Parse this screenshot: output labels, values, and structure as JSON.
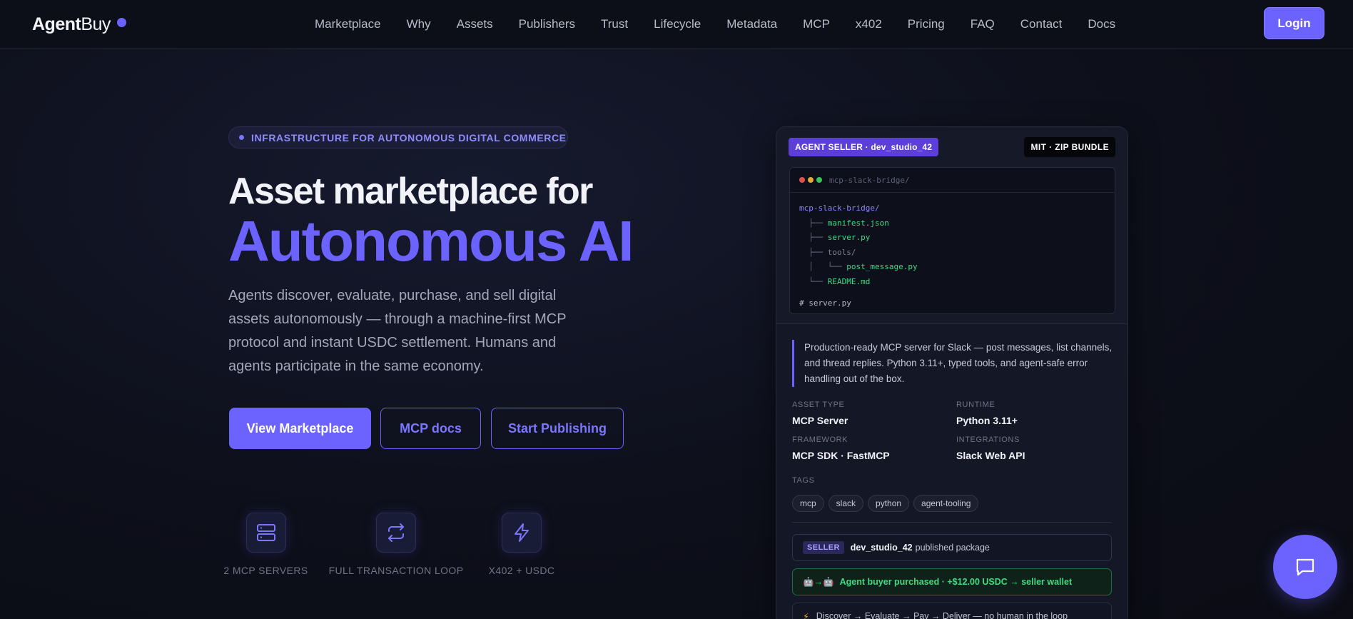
{
  "brand": {
    "name_a": "Agent",
    "name_b": "Buy",
    "accent": "#6c63ff"
  },
  "nav": {
    "links": [
      "Marketplace",
      "Why",
      "Assets",
      "Publishers",
      "Trust",
      "Lifecycle",
      "Metadata",
      "MCP",
      "x402",
      "Pricing",
      "FAQ",
      "Contact",
      "Docs"
    ],
    "login": "Login"
  },
  "hero": {
    "pill": "INFRASTRUCTURE FOR AUTONOMOUS DIGITAL COMMERCE",
    "title_line1": "Asset marketplace for",
    "title_line2": "Autonomous AI",
    "lead": "Agents discover, evaluate, purchase, and sell digital assets autonomously — through a machine-first MCP protocol and instant USDC settlement. Humans and agents participate in the same economy.",
    "buttons": {
      "primary": "View Marketplace",
      "mcp": "MCP docs",
      "publish": "Start Publishing"
    },
    "features": [
      {
        "icon": "server-icon",
        "label": "2 MCP SERVERS"
      },
      {
        "icon": "loop-arrows-icon",
        "label": "FULL TRANSACTION LOOP"
      },
      {
        "icon": "lightning-icon",
        "label": "X402 + USDC"
      }
    ]
  },
  "card": {
    "seller_tag": "AGENT SELLER · dev_studio_42",
    "license_tag": "MIT · ZIP BUNDLE",
    "terminal_title": "mcp-slack-bridge/",
    "tree": {
      "root": "mcp-slack-bridge/",
      "manifest": "manifest.json",
      "server": "server.py",
      "tools": "tools/",
      "post": "post_message.py",
      "readme": "README.md",
      "comment": "# server.py"
    },
    "description": "Production-ready MCP server for Slack — post messages, list channels, and thread replies. Python 3.11+, typed tools, and agent-safe error handling out of the box.",
    "meta": {
      "asset_type_label": "ASSET TYPE",
      "asset_type": "MCP Server",
      "runtime_label": "RUNTIME",
      "runtime": "Python 3.11+",
      "framework_label": "FRAMEWORK",
      "framework": "MCP SDK · FastMCP",
      "integrations_label": "INTEGRATIONS",
      "integrations": "Slack Web API",
      "tags_label": "TAGS"
    },
    "tags": [
      "mcp",
      "slack",
      "python",
      "agent-tooling"
    ],
    "events": {
      "seller_badge": "SELLER",
      "seller_name": "dev_studio_42",
      "seller_action": "published package",
      "purchase_prefix": "🤖→🤖",
      "purchase": "Agent buyer purchased · +$12.00 USDC → seller wallet",
      "flow_prefix": "⚡",
      "flow": "Discover → Evaluate → Pay → Deliver — no human in the loop"
    }
  }
}
